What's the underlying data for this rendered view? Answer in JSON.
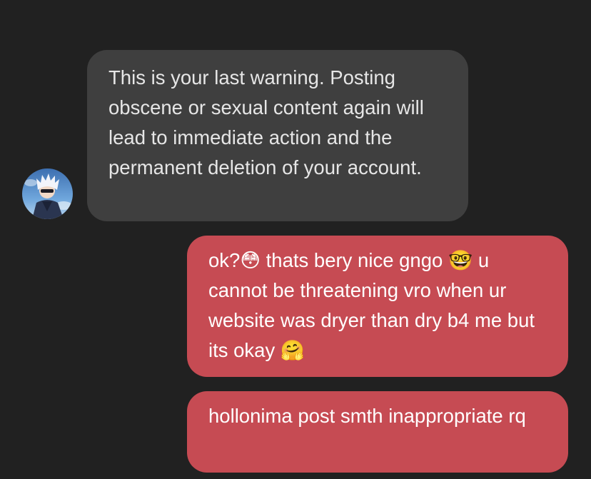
{
  "messages": [
    {
      "sender": "other",
      "text": "This is your last warning. Posting obscene or sexual content again will lead to immediate action and the permanent deletion of your account."
    },
    {
      "sender": "me",
      "text": "ok?😳 thats bery nice gngo 🤓 u cannot be threatening vro when ur website was dryer than dry b4 me but its okay 🤗"
    },
    {
      "sender": "me",
      "text": "hollonima post smth inappropriate rq"
    }
  ],
  "avatar": {
    "icon": "anime-character-avatar-icon"
  },
  "colors": {
    "background": "#212121",
    "incoming_bubble": "#3f3f3f",
    "outgoing_bubble": "#c64b53",
    "incoming_text": "#e6e6e6",
    "outgoing_text": "#ffffff"
  }
}
